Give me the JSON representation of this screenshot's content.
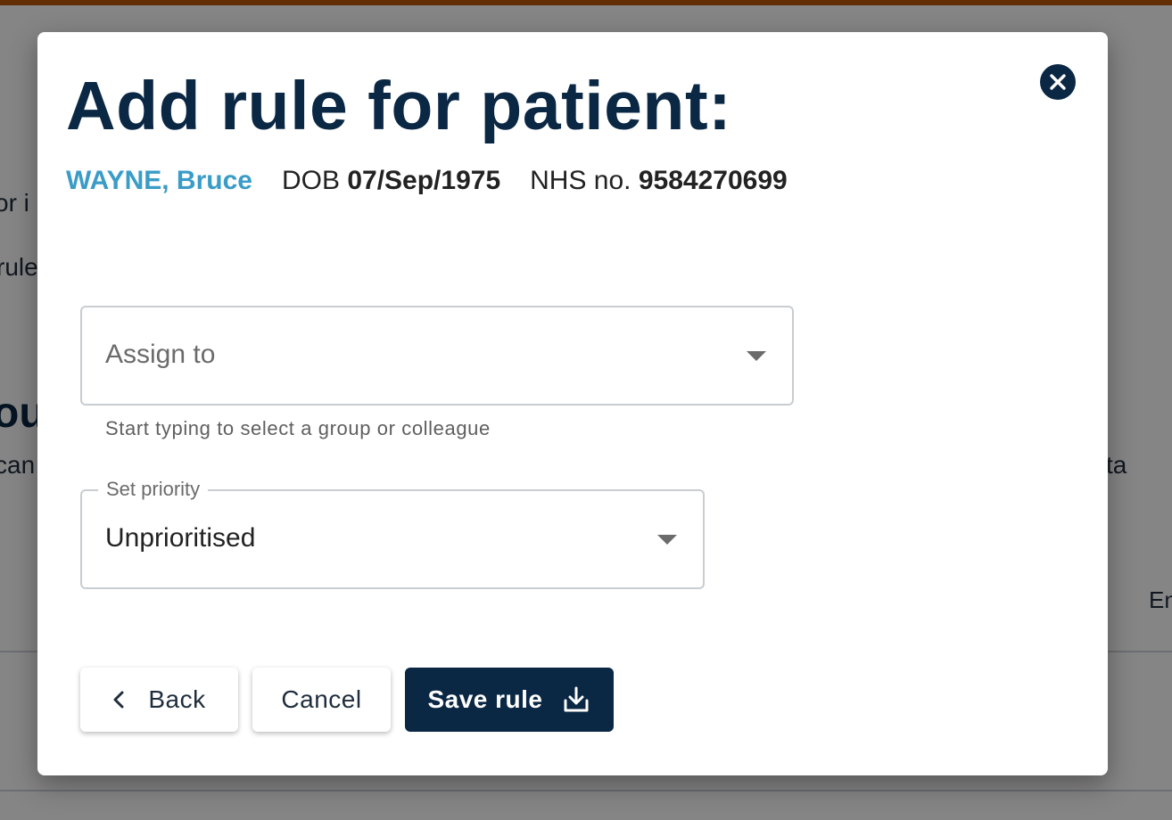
{
  "background": {
    "fragments": [
      "or i",
      "rule",
      "ous",
      "can",
      "ta",
      "En"
    ]
  },
  "modal": {
    "title": "Add rule for patient:",
    "patient": {
      "name": "WAYNE, Bruce",
      "dob_label": "DOB",
      "dob_value": "07/Sep/1975",
      "nhs_label": "NHS no.",
      "nhs_value": "9584270699"
    },
    "assign": {
      "placeholder": "Assign to",
      "helper": "Start typing to select a group or colleague"
    },
    "priority": {
      "label": "Set priority",
      "value": "Unprioritised"
    },
    "buttons": {
      "back": "Back",
      "cancel": "Cancel",
      "save": "Save rule"
    }
  },
  "colors": {
    "accent": "#0a2744",
    "patient_name": "#3a9cc7",
    "top_strip": "#c0590a"
  },
  "icons": [
    "close-icon",
    "chevron-down-icon",
    "chevron-left-icon",
    "download-icon"
  ]
}
